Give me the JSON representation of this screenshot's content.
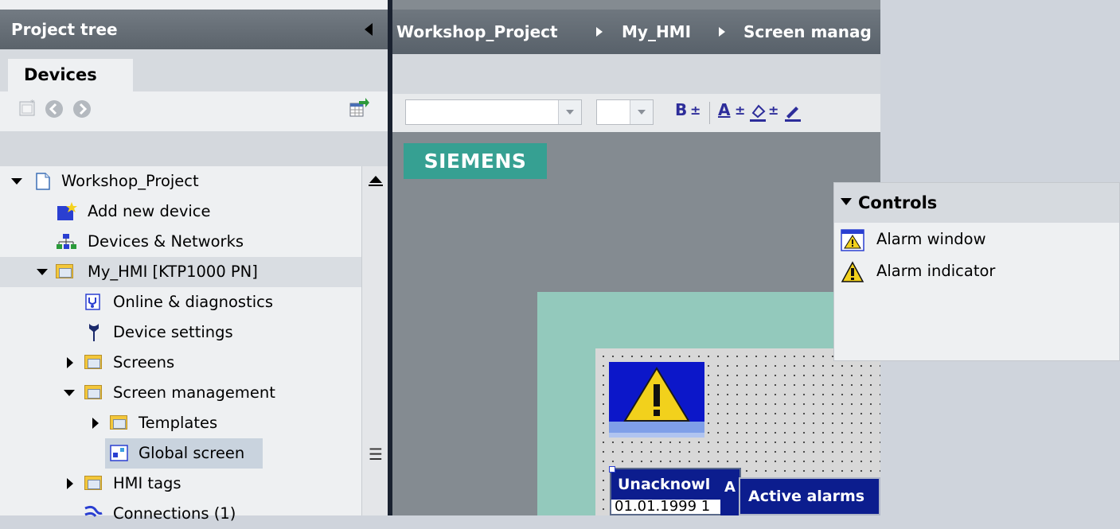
{
  "project_tree": {
    "title": "Project tree",
    "tab": "Devices",
    "items": [
      {
        "label": "Workshop_Project"
      },
      {
        "label": "Add new device"
      },
      {
        "label": "Devices & Networks"
      },
      {
        "label": "My_HMI [KTP1000 PN]"
      },
      {
        "label": "Online & diagnostics"
      },
      {
        "label": "Device settings"
      },
      {
        "label": "Screens"
      },
      {
        "label": "Screen management"
      },
      {
        "label": "Templates"
      },
      {
        "label": "Global screen"
      },
      {
        "label": "HMI tags"
      },
      {
        "label": "Connections (1)"
      }
    ],
    "scroll_grip": "☰"
  },
  "editor": {
    "breadcrumb": [
      "Workshop_Project",
      "My_HMI",
      "Screen manag"
    ],
    "toolbar": {
      "bold": "B",
      "font_color": "A",
      "plus_marks": "±"
    },
    "logo": "SIEMENS",
    "alarm_window_left": {
      "header": "Unacknowl",
      "row": "01.01.1999 1"
    },
    "alarm_window_mini": "A",
    "alarm_window_right": {
      "header": "Active alarms"
    }
  },
  "controls": {
    "title": "Controls",
    "items": [
      {
        "label": "Alarm window"
      },
      {
        "label": "Alarm indicator"
      }
    ]
  },
  "colors": {
    "header_bg": "#5b636b",
    "siemens_teal": "#36a092",
    "alarm_blue": "#0c1d8e",
    "warning_yellow": "#f2d11c",
    "canvas_teal": "#93c9bc"
  }
}
